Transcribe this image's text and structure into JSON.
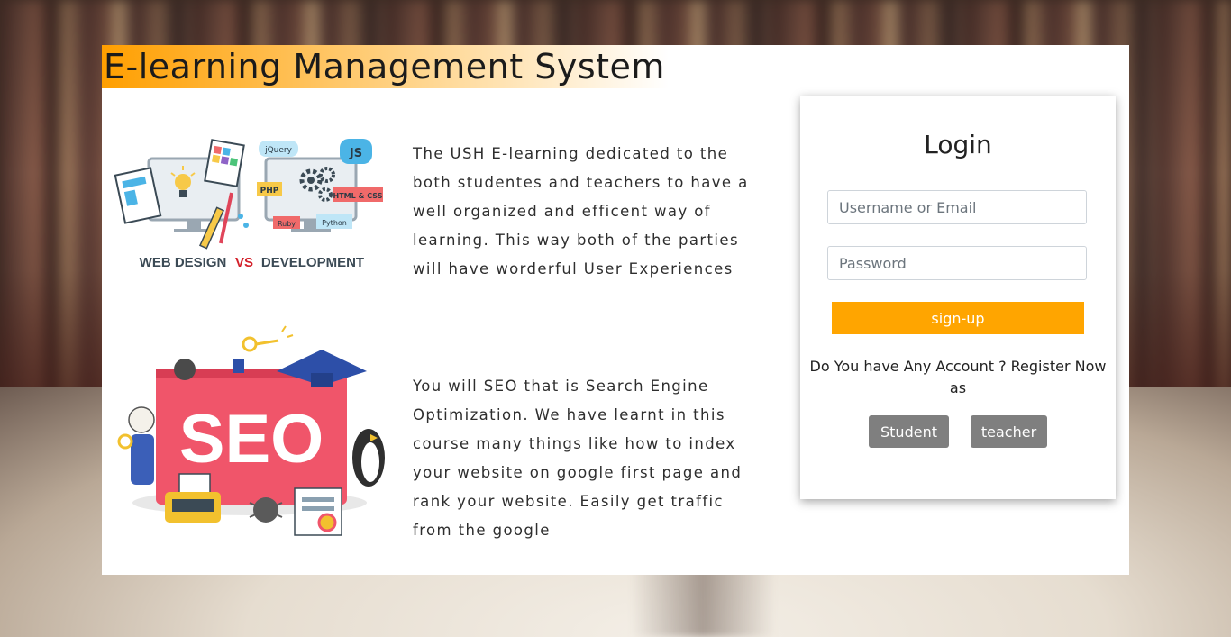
{
  "header": {
    "title": "E-learning Management System"
  },
  "features": [
    {
      "image_label_left": "WEB DESIGN",
      "image_label_mid": "VS",
      "image_label_right": "DEVELOPMENT",
      "text": "The USH E-learning dedicated to the both studentes and teachers to have a well organized and efficent way of learning. This way both of the parties will have worderful User Experiences"
    },
    {
      "image_label": "SEO",
      "text": "You will SEO that is Search Engine Optimization. We have learnt in this course many things like how to index your website on google first page and rank your website. Easily get traffic from the google"
    }
  ],
  "login": {
    "title": "Login",
    "username_placeholder": "Username or Email",
    "password_placeholder": "Password",
    "signup_label": "sign-up",
    "register_text": "Do You have Any Account ? Register Now as",
    "student_label": "Student",
    "teacher_label": "teacher"
  },
  "tech_badges": [
    "jQuery",
    "JS",
    "PHP",
    "HTML & CSS",
    "Ruby",
    "Python"
  ],
  "colors": {
    "accent": "#ffa500",
    "title_gradient_start": "#ff9f00",
    "role_button": "#7f7f7f",
    "seo_board": "#f0556a"
  },
  "icons": [
    "computer-icon",
    "lightbulb-icon",
    "gears-icon",
    "pencil-icon",
    "brush-icon",
    "key-icon",
    "graduation-cap-icon",
    "typewriter-icon",
    "certificate-icon",
    "spider-icon",
    "penguin-icon"
  ]
}
